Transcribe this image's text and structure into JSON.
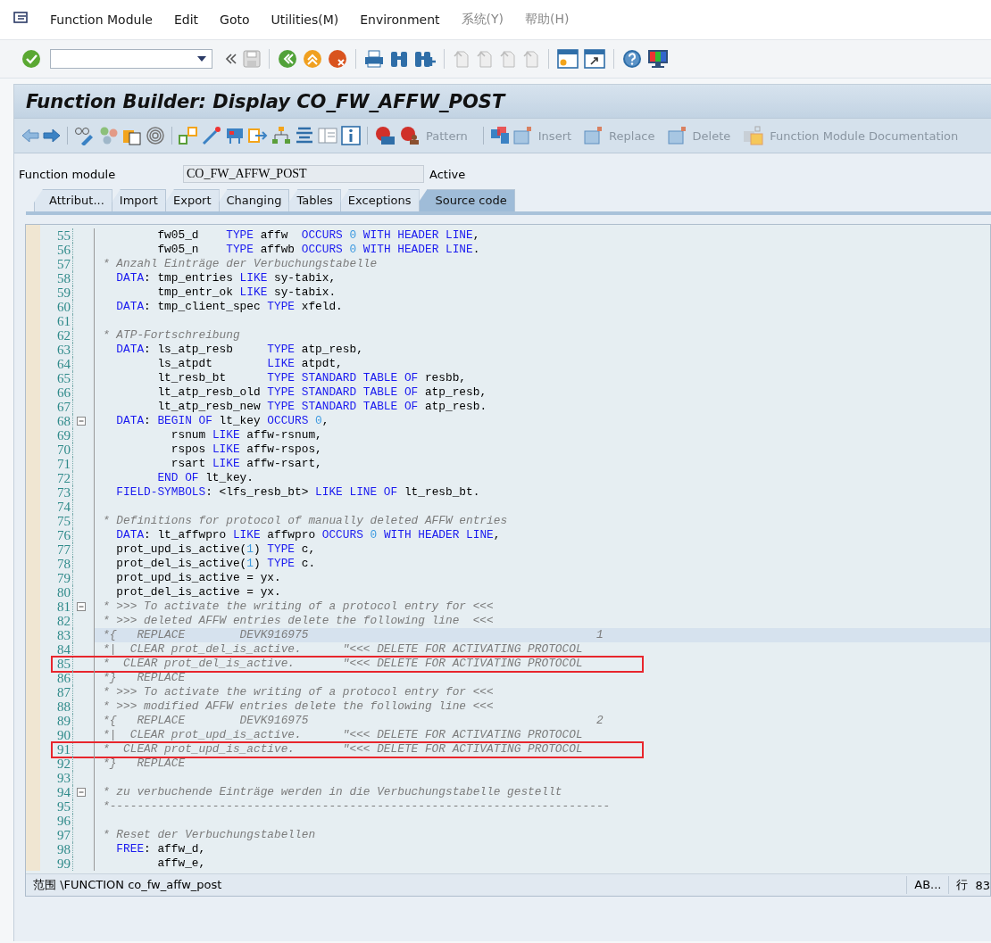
{
  "menu": [
    {
      "label": "Function Module",
      "disabled": false
    },
    {
      "label": "Edit",
      "disabled": false
    },
    {
      "label": "Goto",
      "disabled": false
    },
    {
      "label": "Utilities(M)",
      "disabled": false
    },
    {
      "label": "Environment",
      "disabled": false
    },
    {
      "label": "系统(Y)",
      "disabled": true
    },
    {
      "label": "帮助(H)",
      "disabled": true
    }
  ],
  "window": {
    "title": "Function Builder: Display CO_FW_AFFW_POST"
  },
  "app_toolbar": {
    "buttons": [
      {
        "label": "Pattern",
        "disabled": true
      },
      {
        "label": "Insert",
        "disabled": true
      },
      {
        "label": "Replace",
        "disabled": true
      },
      {
        "label": "Delete",
        "disabled": true
      },
      {
        "label": "Function Module Documentation",
        "disabled": true
      }
    ]
  },
  "header": {
    "label": "Function module",
    "value": "CO_FW_AFFW_POST",
    "status": "Active"
  },
  "tabs": [
    {
      "label": "Attribut...",
      "selected": false
    },
    {
      "label": "Import",
      "selected": false
    },
    {
      "label": "Export",
      "selected": false
    },
    {
      "label": "Changing",
      "selected": false
    },
    {
      "label": "Tables",
      "selected": false
    },
    {
      "label": "Exceptions",
      "selected": false
    },
    {
      "label": "Source code",
      "selected": true
    }
  ],
  "editor": {
    "lines": [
      {
        "number": "55",
        "tokens": [
          {
            "kind": "text",
            "text": "        fw05_d    "
          },
          {
            "kind": "keyword",
            "text": "TYPE"
          },
          {
            "kind": "text",
            "text": " affw  "
          },
          {
            "kind": "keyword",
            "text": "OCCURS "
          },
          {
            "kind": "number",
            "text": "0"
          },
          {
            "kind": "keyword",
            "text": " WITH HEADER LINE"
          },
          {
            "kind": "text",
            "text": ","
          }
        ]
      },
      {
        "number": "56",
        "tokens": [
          {
            "kind": "text",
            "text": "        fw05_n    "
          },
          {
            "kind": "keyword",
            "text": "TYPE"
          },
          {
            "kind": "text",
            "text": " affwb "
          },
          {
            "kind": "keyword",
            "text": "OCCURS "
          },
          {
            "kind": "number",
            "text": "0"
          },
          {
            "kind": "keyword",
            "text": " WITH HEADER LINE"
          },
          {
            "kind": "text",
            "text": "."
          }
        ]
      },
      {
        "number": "57",
        "tokens": [
          {
            "kind": "comment",
            "text": "* Anzahl Einträge der Verbuchungstabelle"
          }
        ]
      },
      {
        "number": "58",
        "tokens": [
          {
            "kind": "keyword",
            "text": "  DATA"
          },
          {
            "kind": "text",
            "text": ": tmp_entries "
          },
          {
            "kind": "keyword",
            "text": "LIKE"
          },
          {
            "kind": "text",
            "text": " sy-tabix,"
          }
        ]
      },
      {
        "number": "59",
        "tokens": [
          {
            "kind": "text",
            "text": "        tmp_entr_ok "
          },
          {
            "kind": "keyword",
            "text": "LIKE"
          },
          {
            "kind": "text",
            "text": " sy-tabix."
          }
        ]
      },
      {
        "number": "60",
        "tokens": [
          {
            "kind": "keyword",
            "text": "  DATA"
          },
          {
            "kind": "text",
            "text": ": tmp_client_spec "
          },
          {
            "kind": "keyword",
            "text": "TYPE"
          },
          {
            "kind": "text",
            "text": " xfeld."
          }
        ]
      },
      {
        "number": "61"
      },
      {
        "number": "62",
        "tokens": [
          {
            "kind": "comment",
            "text": "* ATP-Fortschreibung"
          }
        ]
      },
      {
        "number": "63",
        "tokens": [
          {
            "kind": "keyword",
            "text": "  DATA"
          },
          {
            "kind": "text",
            "text": ": ls_atp_resb     "
          },
          {
            "kind": "keyword",
            "text": "TYPE"
          },
          {
            "kind": "text",
            "text": " atp_resb,"
          }
        ]
      },
      {
        "number": "64",
        "tokens": [
          {
            "kind": "text",
            "text": "        ls_atpdt        "
          },
          {
            "kind": "keyword",
            "text": "LIKE"
          },
          {
            "kind": "text",
            "text": " atpdt,"
          }
        ]
      },
      {
        "number": "65",
        "tokens": [
          {
            "kind": "text",
            "text": "        lt_resb_bt      "
          },
          {
            "kind": "keyword",
            "text": "TYPE STANDARD TABLE OF"
          },
          {
            "kind": "text",
            "text": " resbb,"
          }
        ]
      },
      {
        "number": "66",
        "tokens": [
          {
            "kind": "text",
            "text": "        lt_atp_resb_old "
          },
          {
            "kind": "keyword",
            "text": "TYPE STANDARD TABLE OF"
          },
          {
            "kind": "text",
            "text": " atp_resb,"
          }
        ]
      },
      {
        "number": "67",
        "tokens": [
          {
            "kind": "text",
            "text": "        lt_atp_resb_new "
          },
          {
            "kind": "keyword",
            "text": "TYPE STANDARD TABLE OF"
          },
          {
            "kind": "text",
            "text": " atp_resb."
          }
        ]
      },
      {
        "number": "68",
        "fold": true,
        "tokens": [
          {
            "kind": "keyword",
            "text": "  DATA"
          },
          {
            "kind": "text",
            "text": ": "
          },
          {
            "kind": "keyword",
            "text": "BEGIN OF"
          },
          {
            "kind": "text",
            "text": " lt_key "
          },
          {
            "kind": "keyword",
            "text": "OCCURS "
          },
          {
            "kind": "number",
            "text": "0"
          },
          {
            "kind": "text",
            "text": ","
          }
        ]
      },
      {
        "number": "69",
        "tokens": [
          {
            "kind": "text",
            "text": "          rsnum "
          },
          {
            "kind": "keyword",
            "text": "LIKE"
          },
          {
            "kind": "text",
            "text": " affw-rsnum,"
          }
        ]
      },
      {
        "number": "70",
        "tokens": [
          {
            "kind": "text",
            "text": "          rspos "
          },
          {
            "kind": "keyword",
            "text": "LIKE"
          },
          {
            "kind": "text",
            "text": " affw-rspos,"
          }
        ]
      },
      {
        "number": "71",
        "tokens": [
          {
            "kind": "text",
            "text": "          rsart "
          },
          {
            "kind": "keyword",
            "text": "LIKE"
          },
          {
            "kind": "text",
            "text": " affw-rsart,"
          }
        ]
      },
      {
        "number": "72",
        "tokens": [
          {
            "kind": "keyword",
            "text": "        END OF"
          },
          {
            "kind": "text",
            "text": " lt_key."
          }
        ]
      },
      {
        "number": "73",
        "tokens": [
          {
            "kind": "keyword",
            "text": "  FIELD-SYMBOLS"
          },
          {
            "kind": "text",
            "text": ": <lfs_resb_bt> "
          },
          {
            "kind": "keyword",
            "text": "LIKE LINE OF"
          },
          {
            "kind": "text",
            "text": " lt_resb_bt."
          }
        ]
      },
      {
        "number": "74"
      },
      {
        "number": "75",
        "tokens": [
          {
            "kind": "comment",
            "text": "* Definitions for protocol of manually deleted AFFW entries"
          }
        ]
      },
      {
        "number": "76",
        "tokens": [
          {
            "kind": "keyword",
            "text": "  DATA"
          },
          {
            "kind": "text",
            "text": ": lt_affwpro "
          },
          {
            "kind": "keyword",
            "text": "LIKE"
          },
          {
            "kind": "text",
            "text": " affwpro "
          },
          {
            "kind": "keyword",
            "text": "OCCURS "
          },
          {
            "kind": "number",
            "text": "0"
          },
          {
            "kind": "keyword",
            "text": " WITH HEADER LINE"
          },
          {
            "kind": "text",
            "text": ","
          }
        ]
      },
      {
        "number": "77",
        "tokens": [
          {
            "kind": "text",
            "text": "  prot_upd_is_active("
          },
          {
            "kind": "number",
            "text": "1"
          },
          {
            "kind": "text",
            "text": ") "
          },
          {
            "kind": "keyword",
            "text": "TYPE"
          },
          {
            "kind": "text",
            "text": " c,"
          }
        ]
      },
      {
        "number": "78",
        "tokens": [
          {
            "kind": "text",
            "text": "  prot_del_is_active("
          },
          {
            "kind": "number",
            "text": "1"
          },
          {
            "kind": "text",
            "text": ") "
          },
          {
            "kind": "keyword",
            "text": "TYPE"
          },
          {
            "kind": "text",
            "text": " c."
          }
        ]
      },
      {
        "number": "79",
        "tokens": [
          {
            "kind": "text",
            "text": "  prot_upd_is_active = yx."
          }
        ]
      },
      {
        "number": "80",
        "tokens": [
          {
            "kind": "text",
            "text": "  prot_del_is_active = yx."
          }
        ]
      },
      {
        "number": "81",
        "fold": true,
        "tokens": [
          {
            "kind": "comment",
            "text": "* >>> To activate the writing of a protocol entry for <<<"
          }
        ]
      },
      {
        "number": "82",
        "tokens": [
          {
            "kind": "comment",
            "text": "* >>> deleted AFFW entries delete the following line  <<<"
          }
        ]
      },
      {
        "number": "83",
        "current": true,
        "tokens": [
          {
            "kind": "comment",
            "text": "*{   REPLACE        DEVK916975                                          1"
          }
        ]
      },
      {
        "number": "84",
        "tokens": [
          {
            "kind": "comment",
            "text": "*|  CLEAR prot_del_is_active.      \"<<< DELETE FOR ACTIVATING PROTOCOL"
          }
        ]
      },
      {
        "number": "85",
        "annotated": true,
        "tokens": [
          {
            "kind": "comment",
            "text": "*  CLEAR prot_del_is_active.       \"<<< DELETE FOR ACTIVATING PROTOCOL"
          }
        ]
      },
      {
        "number": "86",
        "tokens": [
          {
            "kind": "comment",
            "text": "*}   REPLACE"
          }
        ]
      },
      {
        "number": "87",
        "tokens": [
          {
            "kind": "comment",
            "text": "* >>> To activate the writing of a protocol entry for <<<"
          }
        ]
      },
      {
        "number": "88",
        "tokens": [
          {
            "kind": "comment",
            "text": "* >>> modified AFFW entries delete the following line <<<"
          }
        ]
      },
      {
        "number": "89",
        "tokens": [
          {
            "kind": "comment",
            "text": "*{   REPLACE        DEVK916975                                          2"
          }
        ]
      },
      {
        "number": "90",
        "tokens": [
          {
            "kind": "comment",
            "text": "*|  CLEAR prot_upd_is_active.      \"<<< DELETE FOR ACTIVATING PROTOCOL"
          }
        ]
      },
      {
        "number": "91",
        "annotated": true,
        "tokens": [
          {
            "kind": "comment",
            "text": "*  CLEAR prot_upd_is_active.       \"<<< DELETE FOR ACTIVATING PROTOCOL"
          }
        ]
      },
      {
        "number": "92",
        "tokens": [
          {
            "kind": "comment",
            "text": "*}   REPLACE"
          }
        ]
      },
      {
        "number": "93"
      },
      {
        "number": "94",
        "fold": true,
        "tokens": [
          {
            "kind": "comment",
            "text": "* zu verbuchende Einträge werden in die Verbuchungstabelle gestellt"
          }
        ]
      },
      {
        "number": "95",
        "tokens": [
          {
            "kind": "comment",
            "text": "*-------------------------------------------------------------------------"
          }
        ]
      },
      {
        "number": "96"
      },
      {
        "number": "97",
        "tokens": [
          {
            "kind": "comment",
            "text": "* Reset der Verbuchungstabellen"
          }
        ]
      },
      {
        "number": "98",
        "tokens": [
          {
            "kind": "keyword",
            "text": "  FREE"
          },
          {
            "kind": "text",
            "text": ": affw_d,"
          }
        ]
      },
      {
        "number": "99",
        "tokens": [
          {
            "kind": "text",
            "text": "        affw_e,"
          }
        ]
      }
    ]
  },
  "status_bar": {
    "scope": "范围 \\FUNCTION co_fw_affw_post",
    "mode": "AB...",
    "line_label": "行",
    "line_value": "83"
  }
}
